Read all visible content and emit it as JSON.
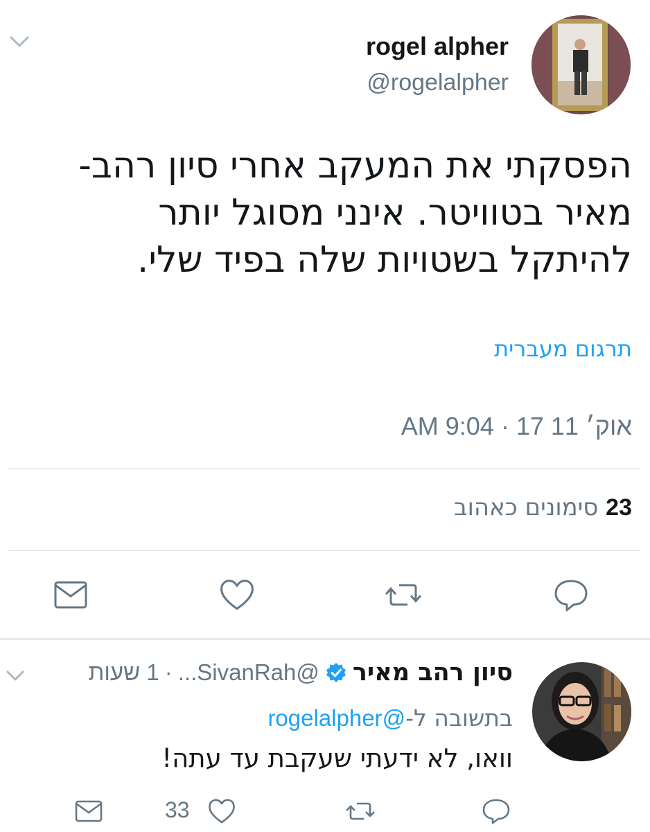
{
  "tweet": {
    "author_name": "rogel alpher",
    "author_handle": "@rogelalpher",
    "text_line1": "הפסקתי את המעקב אחרי סיון רהב-",
    "text_line2": "מאיר בטוויטר. אינני מסוגל יותר",
    "text_line3": "להיתקל בשטויות שלה בפיד שלי.",
    "translate_label": "תרגום מעברית",
    "timestamp": "אוק׳ 11 17 · 9:04 AM",
    "likes_count": "23",
    "likes_label": "סימונים כאהוב",
    "icons": {
      "menu": "chevron-down-icon",
      "reply": "reply-icon",
      "retweet": "retweet-icon",
      "like": "heart-icon",
      "dm": "envelope-icon"
    }
  },
  "reply": {
    "author_name": "סיון רהב מאיר",
    "handle": "@SivanRah...",
    "time": "1 שעות",
    "replying_to_prefix": "בתשובה ל-",
    "replying_to_handle": "@rogelalpher",
    "text": "וואו, לא ידעתי שעקבת עד עתה!",
    "like_count": "33",
    "verified": true
  },
  "colors": {
    "accent": "#1da1f2",
    "secondary_text": "#657786",
    "divider": "#e6ecf0",
    "icon": "#657786"
  }
}
